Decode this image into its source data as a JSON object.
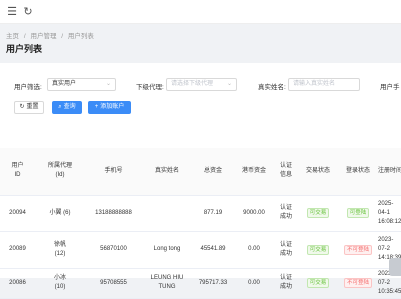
{
  "topbar": {
    "menu_icon": "menu-icon",
    "refresh_icon": "refresh-icon"
  },
  "breadcrumb": [
    "主页",
    "/",
    "用户管理",
    "/",
    "用户列表"
  ],
  "page_title": "用户列表",
  "filters": {
    "user_filter_label": "用户筛选:",
    "user_filter_value": "真实用户",
    "sub_agent_label": "下级代理:",
    "sub_agent_placeholder": "请选择下级代理",
    "real_name_label": "真实姓名:",
    "real_name_placeholder": "请输入真实姓名",
    "user_label_cut": "用户手"
  },
  "buttons": {
    "reset": "重置",
    "search": "查询",
    "add": "添加账户"
  },
  "table": {
    "headers": [
      "用户\nID",
      "所属代理\n(Id)",
      "手机号",
      "真实姓名",
      "总资金",
      "港币资金",
      "认证\n信息",
      "交易状态",
      "登录状态",
      "注册时间"
    ],
    "rows": [
      {
        "id": "20094",
        "agent": "小翼 (6)",
        "phone": "13188888888",
        "name": "",
        "total": "877.19",
        "hkd": "9000.00",
        "auth": "认证\n成功",
        "trade": "可交易",
        "login": "可登陆",
        "reg": "2025-04-1\n16:08:12"
      },
      {
        "id": "20089",
        "agent": "徐帆\n(12)",
        "phone": "56870100",
        "name": "Long tong",
        "total": "45541.89",
        "hkd": "0.00",
        "auth": "认证\n成功",
        "trade": "可交易",
        "login": "不可登陆",
        "reg": "2023-07-2\n14:18:39"
      },
      {
        "id": "20086",
        "agent": "小冰\n(10)",
        "phone": "95708555",
        "name": "LEUNG HIU\nTUNG",
        "total": "795717.33",
        "hkd": "0.00",
        "auth": "认证\n成功",
        "trade": "可交易",
        "login": "不可登陆",
        "reg": "2023-07-2\n10:35:45"
      }
    ]
  },
  "colors": {
    "primary": "#3b8cf7",
    "success": "#67c23a",
    "danger": "#f56c6c",
    "warning": "#e6a23c"
  }
}
